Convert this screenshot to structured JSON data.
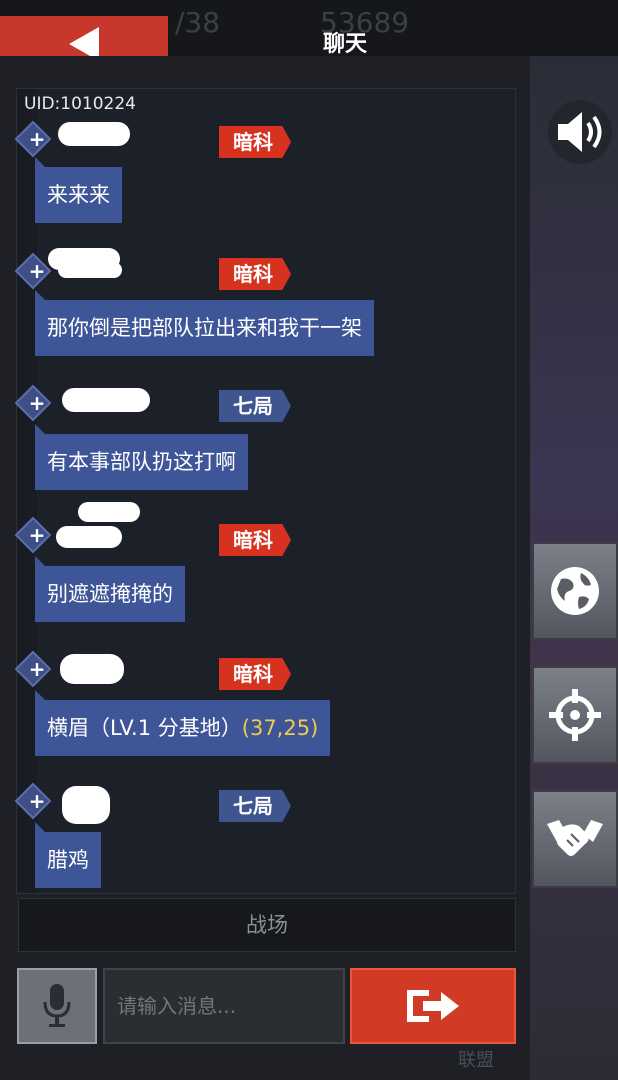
{
  "header": {
    "title": "聊天",
    "bg_ghost_left": "/38",
    "bg_ghost_right": "53689"
  },
  "chat": {
    "uid": "UID:1010224",
    "messages": [
      {
        "tag": "暗科",
        "tag_color": "#d6321f",
        "text": "来来来",
        "coord": ""
      },
      {
        "tag": "暗科",
        "tag_color": "#d6321f",
        "text": "那你倒是把部队拉出来和我干一架",
        "coord": ""
      },
      {
        "tag": "七局",
        "tag_color": "#3f5590",
        "text": "有本事部队扔这打啊",
        "coord": ""
      },
      {
        "tag": "暗科",
        "tag_color": "#d6321f",
        "text": "别遮遮掩掩的",
        "coord": ""
      },
      {
        "tag": "暗科",
        "tag_color": "#d6321f",
        "text": "横眉（LV.1 分基地）",
        "coord": "(37,25)"
      },
      {
        "tag": "七局",
        "tag_color": "#3f5590",
        "text": "腊鸡",
        "coord": ""
      }
    ]
  },
  "channel": {
    "label": "战场"
  },
  "input": {
    "placeholder": "请输入消息..."
  },
  "bottom_ghost": "联盟",
  "icons": {
    "back": "back-arrow-icon",
    "speaker": "speaker-icon",
    "globe": "globe-icon",
    "target": "crosshair-icon",
    "alliance": "handshake-icon",
    "mic": "microphone-icon",
    "send": "send-arrow-icon"
  },
  "colors": {
    "accent_red": "#c8372b",
    "bubble_blue": "#3e5598",
    "coord_yellow": "#f2c94c"
  }
}
